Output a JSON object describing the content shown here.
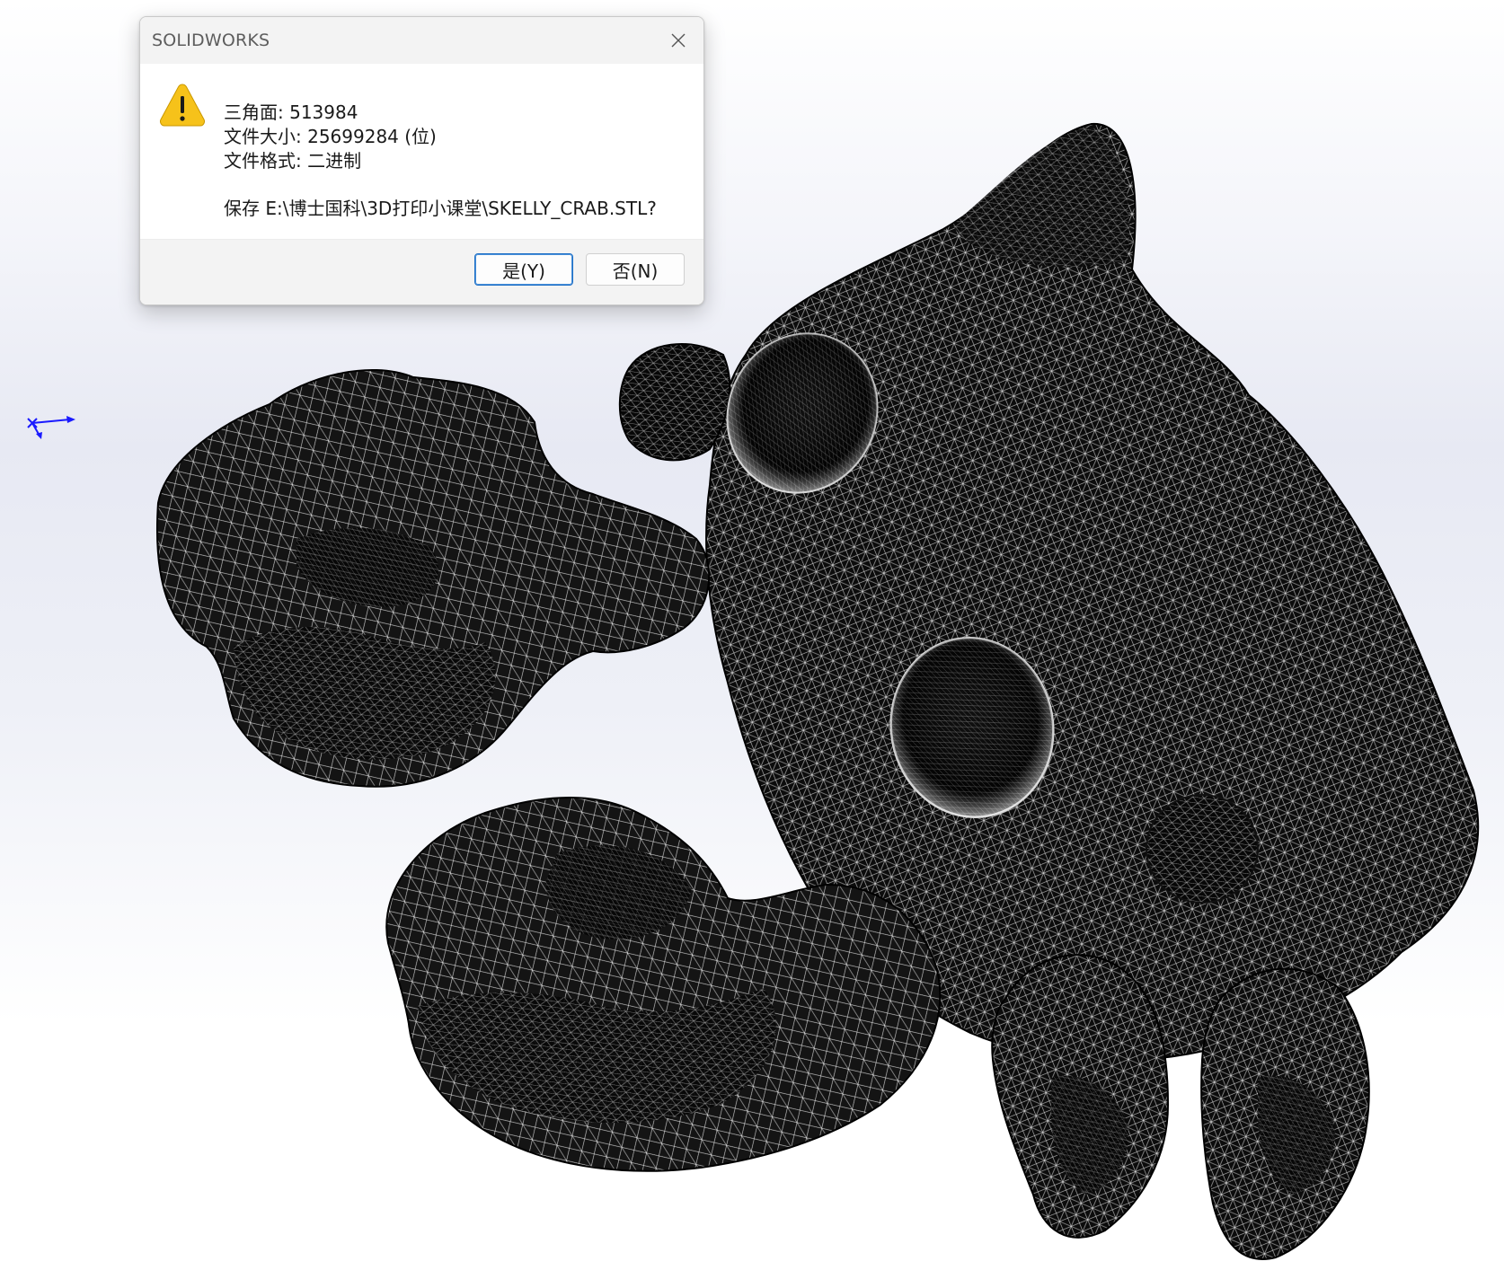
{
  "dialog": {
    "title": "SOLIDWORKS",
    "lines": [
      "三角面: 513984",
      "文件大小: 25699284 (位)",
      "文件格式: 二进制",
      "保存 E:\\博士国科\\3D打印小课堂\\SKELLY_CRAB.STL?"
    ],
    "buttons": {
      "yes": "是(Y)",
      "no": "否(N)"
    },
    "icon": "warning-icon"
  },
  "viewport": {
    "model": "mesh-wireframe",
    "triad": "coordinate-triad-icon"
  },
  "colors": {
    "mesh_fill": "#0c0c0c",
    "mesh_line": "#ffffff",
    "warning_yellow": "#f6c21a",
    "triad_blue": "#1a1aff",
    "accent": "#1d6fc6"
  }
}
